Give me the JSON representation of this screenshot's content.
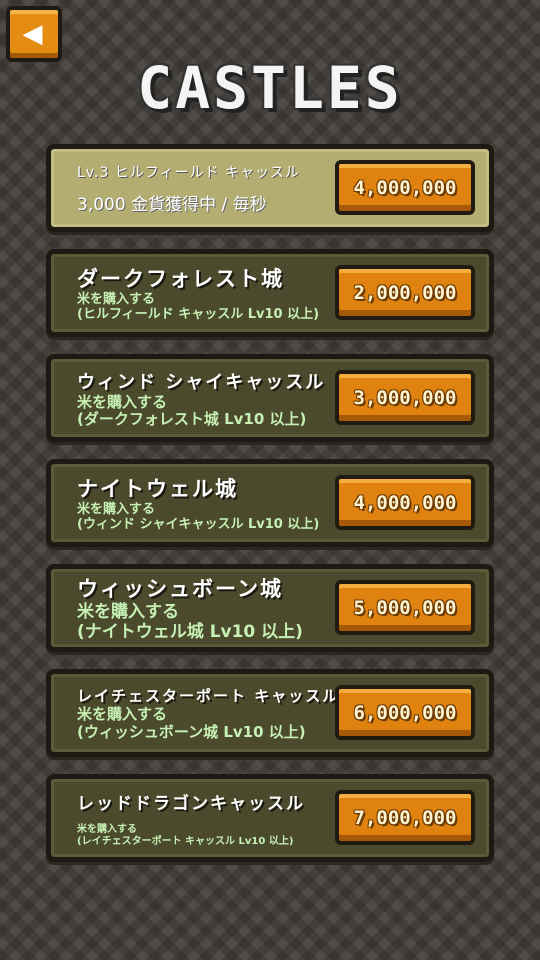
{
  "header": {
    "back_icon": "◀",
    "title": "CASTLES"
  },
  "current_castle": {
    "level_label": "Lv.3 ヒルフィールド キャッスル",
    "income": "3,000 金貨獲得中 / 毎秒",
    "upgrade_price": "4,000,000"
  },
  "castles": [
    {
      "name": "ダークフォレスト城",
      "req_line1": "米を購入する",
      "req_line2": "(ヒルフィールド キャッスル Lv10 以上)",
      "price": "2,000,000"
    },
    {
      "name": "ウィンド シャイキャッスル",
      "req_line1": "米を購入する",
      "req_line2": "(ダークフォレスト城 Lv10 以上)",
      "price": "3,000,000"
    },
    {
      "name": "ナイトウェル城",
      "req_line1": "米を購入する",
      "req_line2": "(ウィンド シャイキャッスル Lv10 以上)",
      "price": "4,000,000"
    },
    {
      "name": "ウィッシュボーン城",
      "req_line1": "米を購入する",
      "req_line2": "(ナイトウェル城 Lv10 以上)",
      "price": "5,000,000"
    },
    {
      "name": "レイチェスターポート キャッスル",
      "req_line1": "米を購入する",
      "req_line2": "(ウィッシュボーン城 Lv10 以上)",
      "price": "6,000,000"
    },
    {
      "name": "レッドドラゴンキャッスル",
      "req_line1": "米を購入する",
      "req_line2": "(レイチェスターポート キャッスル Lv10 以上)",
      "price": "7,000,000"
    }
  ]
}
